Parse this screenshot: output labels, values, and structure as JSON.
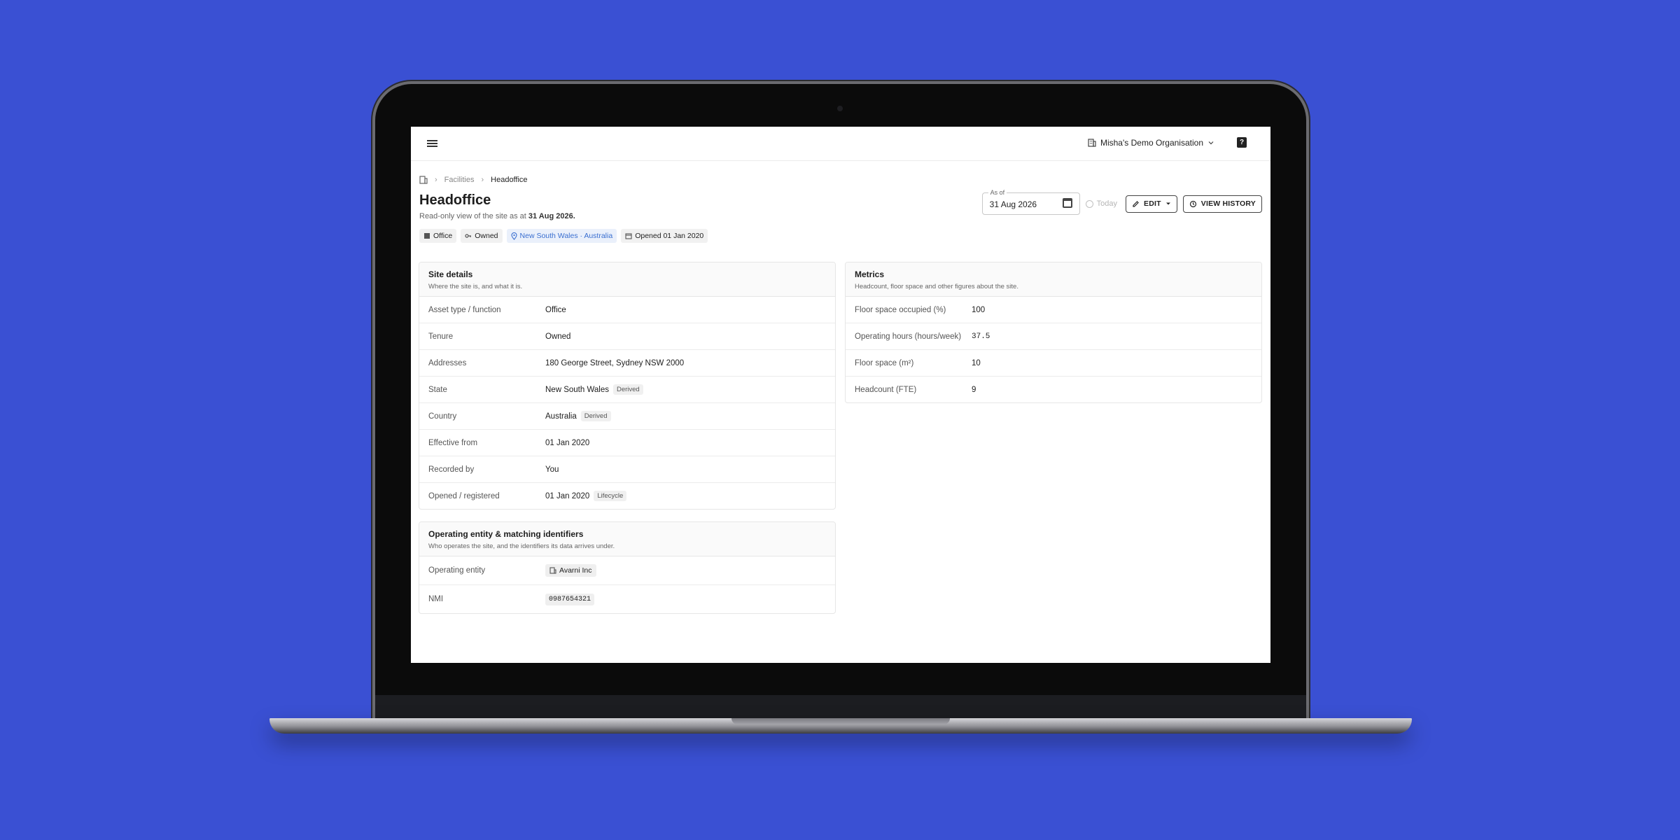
{
  "topbar": {
    "org_name": "Misha's Demo Organisation",
    "help_label": "?"
  },
  "breadcrumb": {
    "facilities": "Facilities",
    "current": "Headoffice"
  },
  "page": {
    "title": "Headoffice",
    "subtitle_prefix": "Read-only view of the site as at",
    "subtitle_date": "31 Aug 2026."
  },
  "chips": {
    "type": "Office",
    "tenure": "Owned",
    "location": "New South Wales · Australia",
    "opened": "Opened 01 Jan 2020"
  },
  "controls": {
    "asof_label": "As of",
    "asof_value": "31 Aug 2026",
    "today_label": "Today",
    "edit_label": "EDIT",
    "history_label": "VIEW HISTORY"
  },
  "site_details": {
    "title": "Site details",
    "subtitle": "Where the site is, and what it is.",
    "rows": [
      {
        "key": "Asset type / function",
        "value": "Office",
        "tag": ""
      },
      {
        "key": "Tenure",
        "value": "Owned",
        "tag": ""
      },
      {
        "key": "Addresses",
        "value": "180 George Street, Sydney NSW 2000",
        "tag": ""
      },
      {
        "key": "State",
        "value": "New South Wales",
        "tag": "Derived"
      },
      {
        "key": "Country",
        "value": "Australia",
        "tag": "Derived"
      },
      {
        "key": "Effective from",
        "value": "01 Jan 2020",
        "tag": ""
      },
      {
        "key": "Recorded by",
        "value": "You",
        "tag": ""
      },
      {
        "key": "Opened / registered",
        "value": "01 Jan 2020",
        "tag": "Lifecycle"
      }
    ]
  },
  "operating": {
    "title": "Operating entity & matching identifiers",
    "subtitle": "Who operates the site, and the identifiers its data arrives under.",
    "entity_key": "Operating entity",
    "entity_value": "Avarni Inc",
    "nmi_key": "NMI",
    "nmi_value": "0987654321"
  },
  "metrics": {
    "title": "Metrics",
    "subtitle": "Headcount, floor space and other figures about the site.",
    "rows": [
      {
        "key": "Floor space occupied (%)",
        "value": "100"
      },
      {
        "key": "Operating hours (hours/week)",
        "value": "37.5"
      },
      {
        "key": "Floor space (m²)",
        "value": "10"
      },
      {
        "key": "Headcount (FTE)",
        "value": "9"
      }
    ]
  },
  "colors": {
    "background": "#3a50d3",
    "location_chip_text": "#3a6fd0"
  }
}
